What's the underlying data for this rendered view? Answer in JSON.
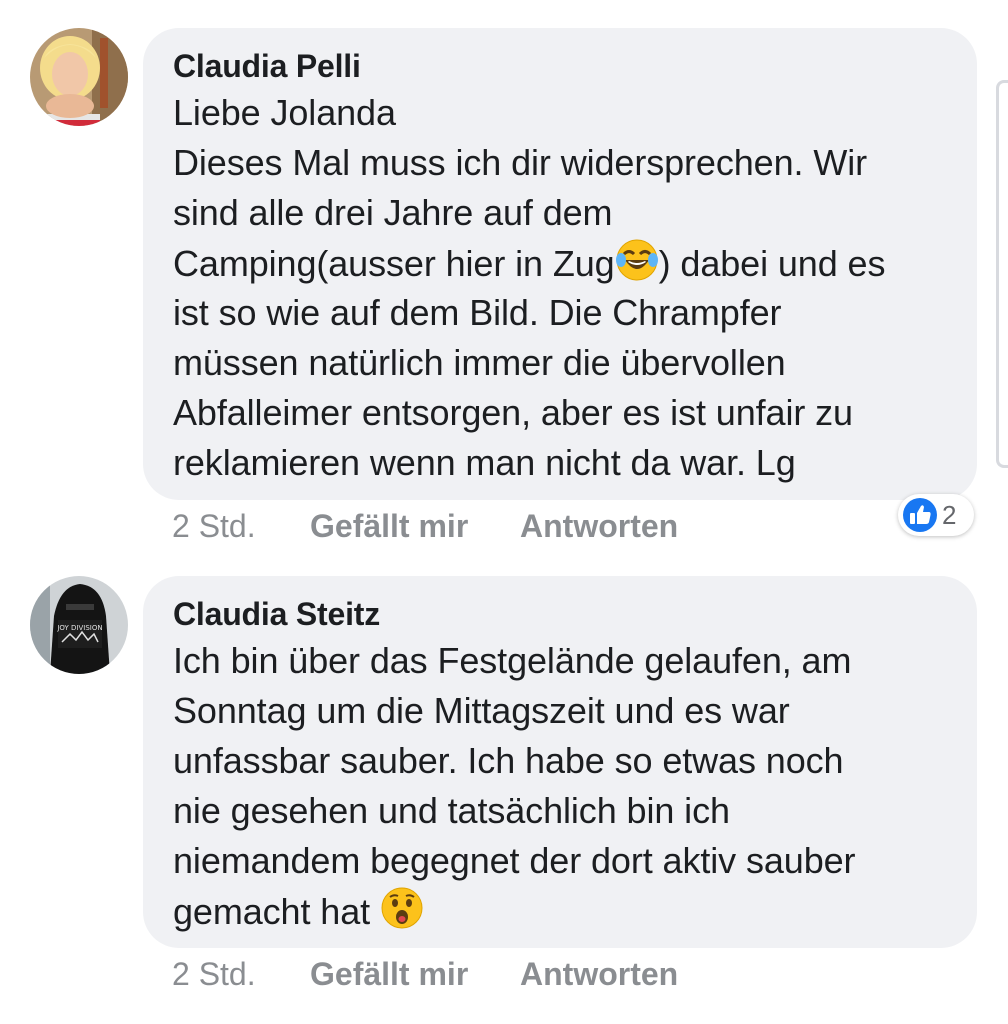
{
  "comments": [
    {
      "author": "Claudia Pelli",
      "lines": [
        "Liebe Jolanda",
        "Dieses Mal muss ich dir widersprechen. Wir",
        "sind alle drei Jahre auf dem"
      ],
      "line_emoji": {
        "before": "Camping(ausser hier in Zug",
        "emoji": "face-with-tears-of-joy-emoji",
        "after": ") dabei und es"
      },
      "lines_after": [
        "ist so wie auf dem Bild. Die Chrampfer",
        "müssen natürlich immer die übervollen",
        "Abfalleimer entsorgen, aber es ist unfair zu",
        "reklamieren wenn man nicht da war. Lg"
      ],
      "time": "2 Std.",
      "like_label": "Gefällt mir",
      "reply_label": "Antworten",
      "reaction": {
        "icon": "like-thumb-icon",
        "count": "2",
        "color": "#1877f2"
      }
    },
    {
      "author": "Claudia Steitz",
      "lines": [
        "Ich bin über das Festgelände gelaufen, am",
        "Sonntag um die Mittagszeit und es war",
        "unfassbar sauber. Ich habe so etwas noch",
        "nie gesehen und tatsächlich bin ich",
        "niemandem begegnet der dort aktiv sauber"
      ],
      "last_line": {
        "text": "gemacht hat ",
        "emoji": "hushed-face-emoji"
      },
      "time": "2 Std.",
      "like_label": "Gefällt mir",
      "reply_label": "Antworten"
    }
  ],
  "colors": {
    "bubble": "#f0f1f4",
    "text": "#1c1e21",
    "meta": "#8a8d91",
    "like_blue": "#1877f2"
  }
}
